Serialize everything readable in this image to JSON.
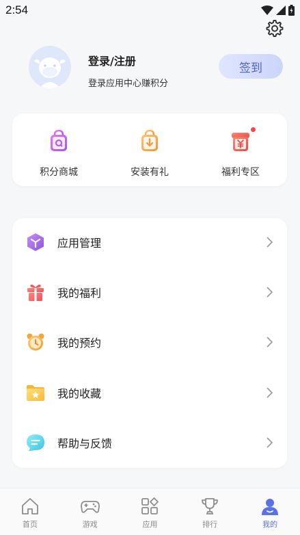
{
  "status_bar": {
    "time": "2:54"
  },
  "profile": {
    "title": "登录/注册",
    "subtitle": "登录应用中心赚积分",
    "signin_label": "签到"
  },
  "quick_actions": [
    {
      "label": "积分商城",
      "icon": "shopping-bag-icon"
    },
    {
      "label": "安装有礼",
      "icon": "download-bag-icon"
    },
    {
      "label": "福利专区",
      "icon": "yuan-box-icon"
    }
  ],
  "menu": [
    {
      "label": "应用管理",
      "icon": "cube-icon"
    },
    {
      "label": "我的福利",
      "icon": "gift-icon"
    },
    {
      "label": "我的预约",
      "icon": "alarm-clock-icon"
    },
    {
      "label": "我的收藏",
      "icon": "folder-star-icon"
    },
    {
      "label": "帮助与反馈",
      "icon": "chat-bubble-icon"
    }
  ],
  "tabs": [
    {
      "label": "首页",
      "icon": "home-icon"
    },
    {
      "label": "游戏",
      "icon": "gamepad-icon"
    },
    {
      "label": "应用",
      "icon": "apps-grid-icon"
    },
    {
      "label": "排行",
      "icon": "trophy-icon"
    },
    {
      "label": "我的",
      "icon": "profile-icon",
      "active": true
    }
  ],
  "colors": {
    "accent": "#5a72e6",
    "signin_text": "#4f62c8"
  }
}
